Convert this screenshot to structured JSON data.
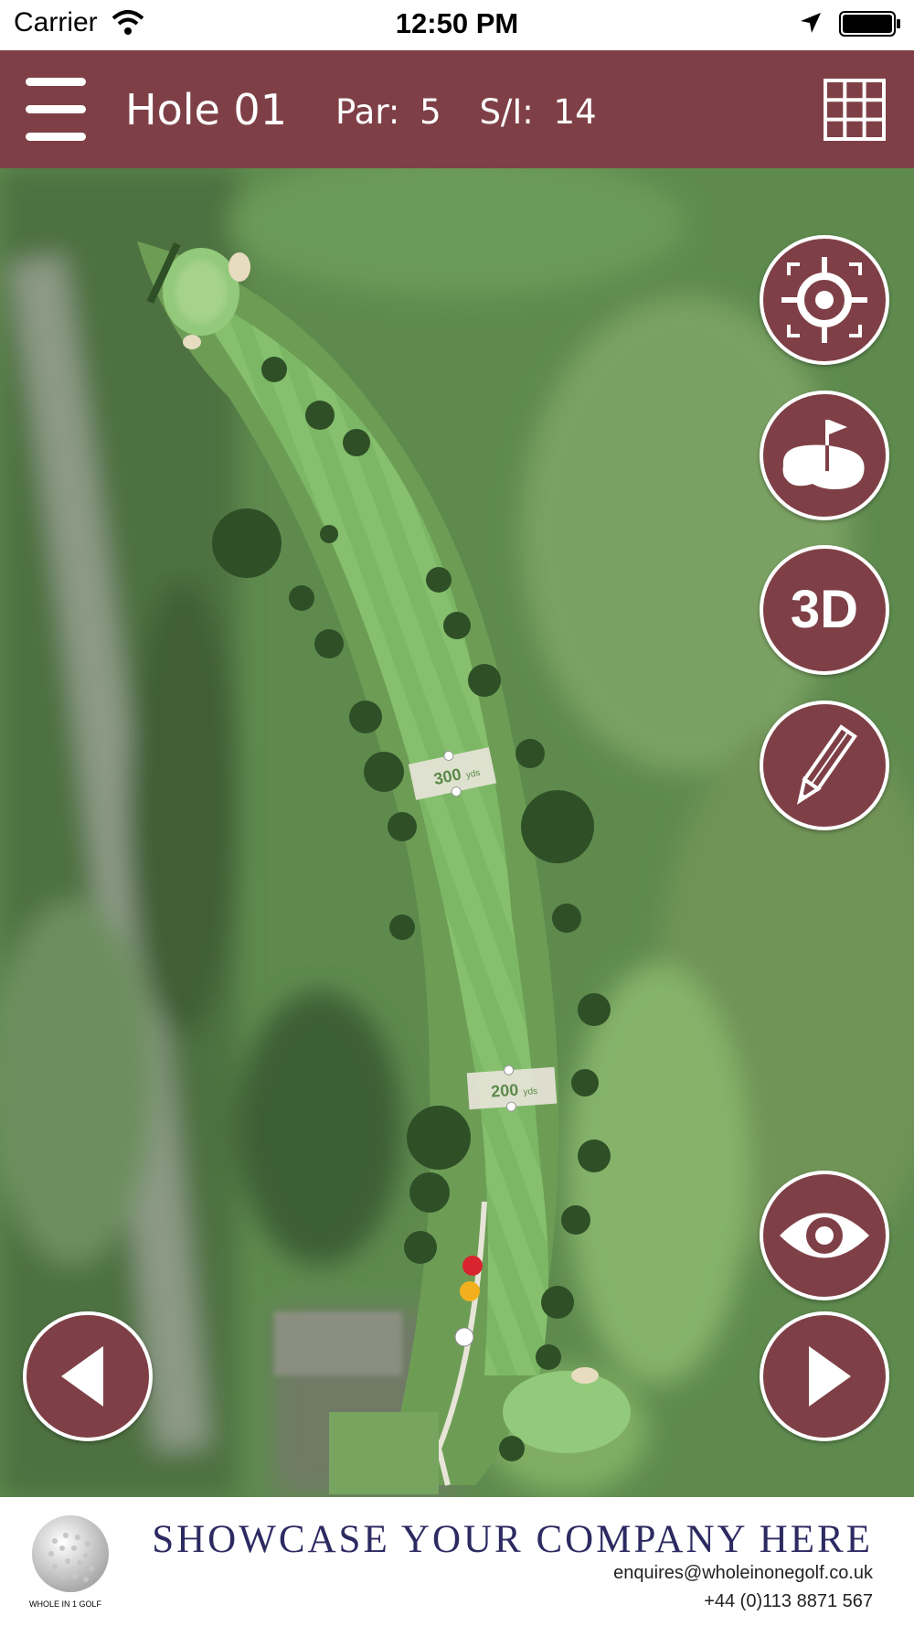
{
  "status_bar": {
    "carrier": "Carrier",
    "time": "12:50 PM"
  },
  "header": {
    "title": "Hole 01",
    "par_label": "Par:",
    "par": "5",
    "si_label": "S/I:",
    "si": "14"
  },
  "map": {
    "markers": [
      {
        "label": "300",
        "unit": "yds"
      },
      {
        "label": "200",
        "unit": "yds"
      }
    ],
    "tee_colors": [
      "#d9232e",
      "#f2b01e",
      "#ffffff"
    ]
  },
  "buttons": {
    "locate": "target-icon",
    "green": "green-flag-icon",
    "three_d": "3D",
    "draw": "pencil-icon",
    "view": "eye-icon",
    "prev": "left-arrow-icon",
    "next": "right-arrow-icon"
  },
  "footer": {
    "brand": "WHOLE IN 1 GOLF",
    "slogan": "SHOWCASE YOUR COMPANY HERE",
    "email": "enquires@wholeinonegolf.co.uk",
    "phone": "+44 (0)113 8871 567"
  },
  "colors": {
    "brand": "#7e4046",
    "slogan": "#2d2a62"
  }
}
